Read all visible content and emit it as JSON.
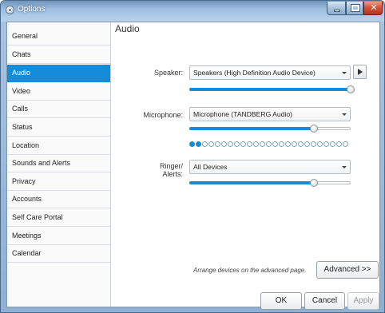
{
  "window": {
    "title": "Options"
  },
  "sidebar": {
    "items": [
      {
        "label": "General",
        "active": false
      },
      {
        "label": "Chats",
        "active": false
      },
      {
        "label": "Audio",
        "active": true
      },
      {
        "label": "Video",
        "active": false
      },
      {
        "label": "Calls",
        "active": false
      },
      {
        "label": "Status",
        "active": false
      },
      {
        "label": "Location",
        "active": false
      },
      {
        "label": "Sounds and Alerts",
        "active": false
      },
      {
        "label": "Privacy",
        "active": false
      },
      {
        "label": "Accounts",
        "active": false
      },
      {
        "label": "Self Care Portal",
        "active": false
      },
      {
        "label": "Meetings",
        "active": false
      },
      {
        "label": "Calendar",
        "active": false
      }
    ]
  },
  "audio": {
    "title": "Audio",
    "speaker": {
      "label": "Speaker:",
      "device": "Speakers (High Definition Audio Device)",
      "volume": 1.0
    },
    "microphone": {
      "label": "Microphone:",
      "device": "Microphone (TANDBERG Audio)",
      "volume": 0.77,
      "level_dots_on": 2,
      "level_dots_total": 25
    },
    "ringer": {
      "label_line1": "Ringer/",
      "label_line2": "Alerts:",
      "device": "All Devices",
      "volume": 0.77
    },
    "advanced_note": "Arrange devices on the advanced page.",
    "advanced_button": "Advanced >>"
  },
  "footer": {
    "ok": "OK",
    "cancel": "Cancel",
    "apply": "Apply"
  },
  "colors": {
    "accent": "#168bd8",
    "titlebar": "#9fbfe0",
    "close_button": "#c8412a"
  }
}
